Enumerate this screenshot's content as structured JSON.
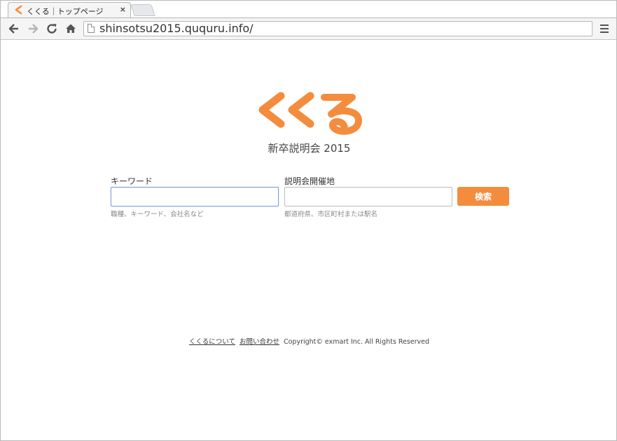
{
  "browser": {
    "tab_title": "くくる｜トップページ",
    "tab_close": "×",
    "url": "shinsotsu2015.ququru.info/",
    "back_icon": "back-arrow-icon",
    "forward_icon": "forward-arrow-icon",
    "reload_icon": "reload-icon",
    "home_icon": "home-icon",
    "menu_icon": "hamburger-menu-icon"
  },
  "page": {
    "logo_text": "くくる",
    "subtitle": "新卒説明会 2015",
    "keyword": {
      "label": "キーワード",
      "value": "",
      "hint": "職種、キーワード、会社名など"
    },
    "location": {
      "label": "説明会開催地",
      "value": "",
      "hint": "都道府県、市区町村または駅名"
    },
    "search_button": "検索",
    "footer": {
      "about_link": "くくるについて",
      "contact_link": "お問い合わせ",
      "copyright": "Copyright© exmart Inc. All Rights Reserved"
    }
  },
  "colors": {
    "brand_orange": "#f48c3d",
    "focus_border": "#7f9fd6"
  }
}
